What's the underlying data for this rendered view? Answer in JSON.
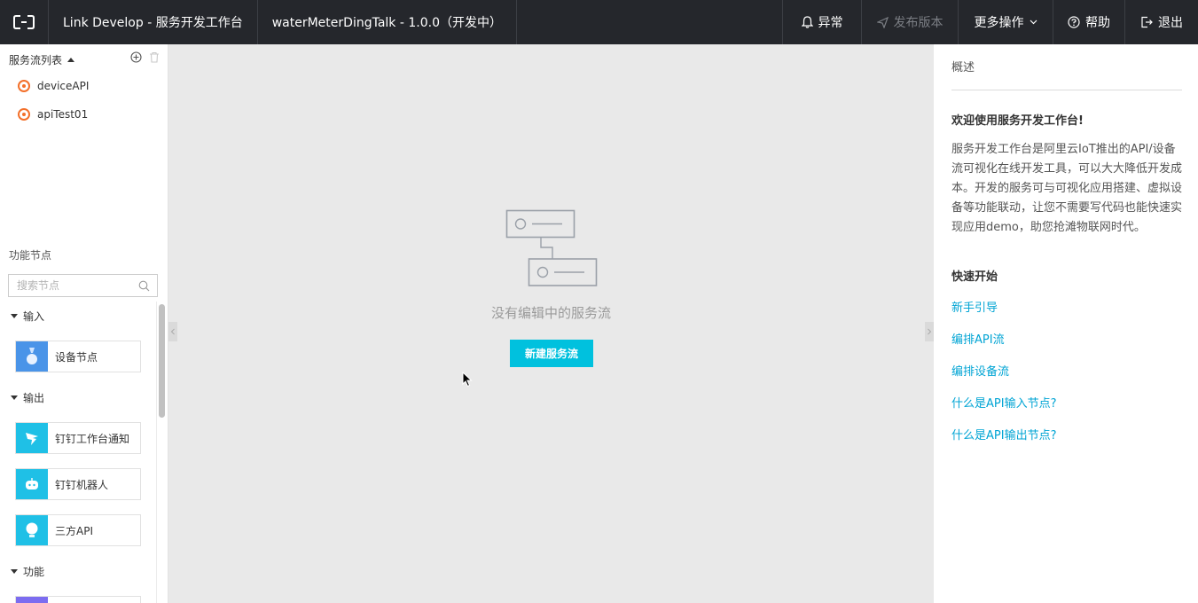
{
  "topbar": {
    "brand": "Link Develop - 服务开发工作台",
    "project": "waterMeterDingTalk - 1.0.0（开发中）",
    "actions": {
      "exception": "异常",
      "publish": "发布版本",
      "more": "更多操作",
      "help": "帮助",
      "logout": "退出"
    }
  },
  "sidebar": {
    "flow_list_title": "服务流列表",
    "flows": [
      "deviceAPI",
      "apiTest01"
    ],
    "func_title": "功能节点",
    "search_placeholder": "搜索节点",
    "groups": {
      "input": "输入",
      "output": "输出",
      "function": "功能"
    },
    "nodes": {
      "device": "设备节点",
      "ding_notice": "钉钉工作台通知",
      "ding_robot": "钉钉机器人",
      "third_api": "三方API"
    }
  },
  "canvas": {
    "empty_text": "没有编辑中的服务流",
    "new_button": "新建服务流"
  },
  "overview": {
    "title": "概述",
    "welcome": "欢迎使用服务开发工作台!",
    "description": "服务开发工作台是阿里云IoT推出的API/设备流可视化在线开发工具，可以大大降低开发成本。开发的服务可与可视化应用搭建、虚拟设备等功能联动，让您不需要写代码也能快速实现应用demo，助您抢滩物联网时代。",
    "quick_start": "快速开始",
    "links": [
      "新手引导",
      "编排API流",
      "编排设备流",
      "什么是API输入节点?",
      "什么是API输出节点?"
    ]
  },
  "colors": {
    "accent": "#00c1de",
    "link": "#00a4d4",
    "topbar": "#25272c",
    "flow_icon": "#f3702a"
  }
}
